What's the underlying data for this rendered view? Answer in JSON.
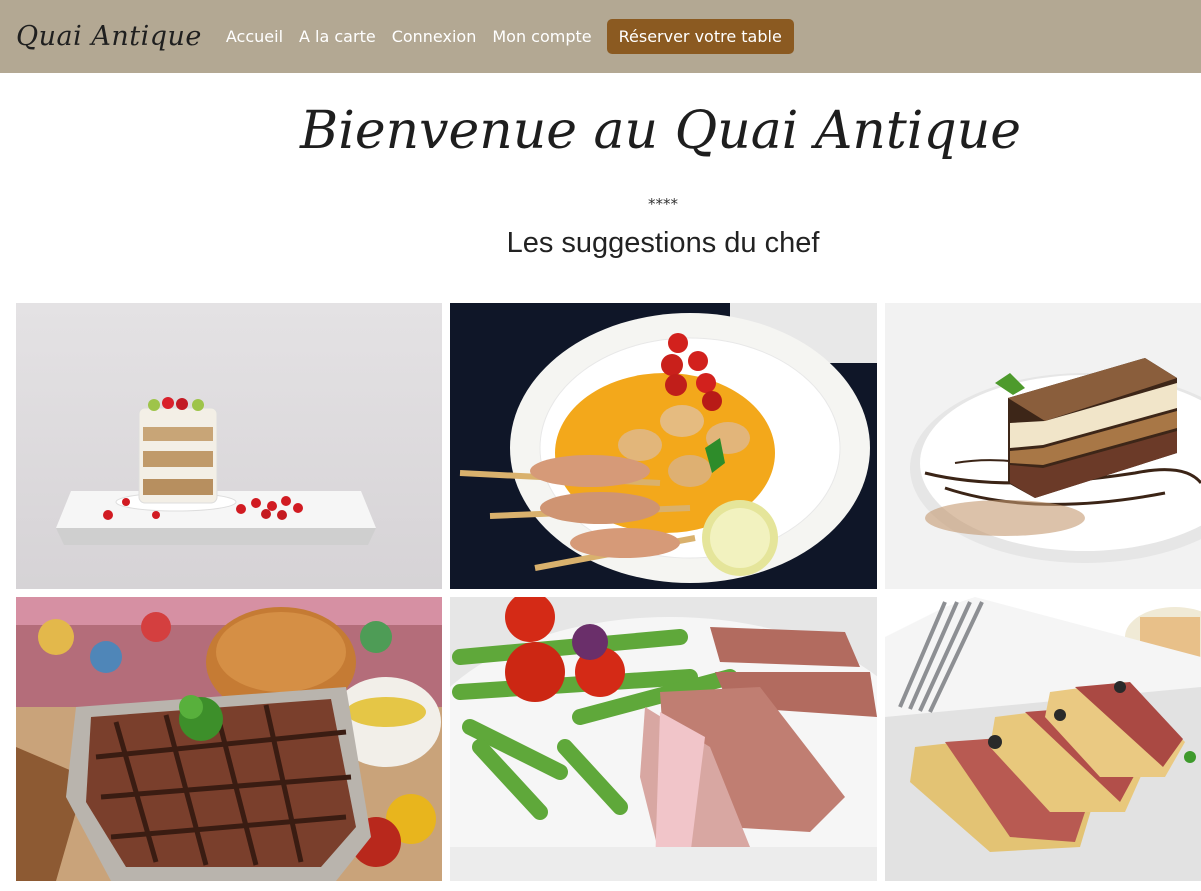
{
  "navbar": {
    "brand": "Quai Antique",
    "links": [
      "Accueil",
      "A la carte",
      "Connexion",
      "Mon compte"
    ],
    "reserve_button": "Réserver votre table"
  },
  "hero": {
    "title": "Bienvenue au Quai Antique",
    "separator": "****"
  },
  "suggestions": {
    "title": "Les suggestions du chef"
  },
  "colors": {
    "navbar_bg": "#b3a893",
    "reserve_button_bg": "#8b5a21"
  }
}
